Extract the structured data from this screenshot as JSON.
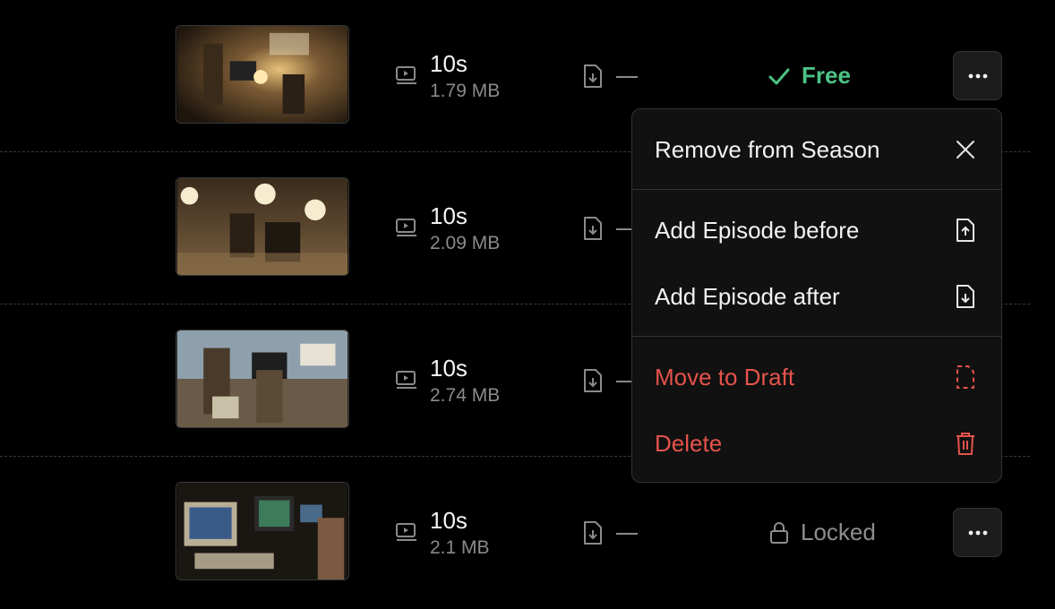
{
  "episodes": [
    {
      "duration": "10s",
      "size": "1.79 MB",
      "status": "Free",
      "thumb": "vintage-projector-scene"
    },
    {
      "duration": "10s",
      "size": "2.09 MB",
      "status": "",
      "thumb": "film-studio-set"
    },
    {
      "duration": "10s",
      "size": "2.74 MB",
      "status": "",
      "thumb": "street-protest-camera"
    },
    {
      "duration": "10s",
      "size": "2.1 MB",
      "status": "Locked",
      "thumb": "retro-editing-room"
    }
  ],
  "menu": {
    "remove_label": "Remove from Season",
    "add_before_label": "Add Episode before",
    "add_after_label": "Add Episode after",
    "move_draft_label": "Move to Draft",
    "delete_label": "Delete"
  },
  "icons": {
    "media": "video-icon",
    "download": "file-download-icon",
    "more": "more-horizontal-icon",
    "free": "check-icon",
    "locked": "lock-icon",
    "remove": "close-icon",
    "add_before": "file-upload-icon",
    "add_after": "file-download-icon",
    "draft": "dashed-file-icon",
    "delete": "trash-icon"
  },
  "colors": {
    "background": "#000000",
    "free": "#4cc285",
    "danger": "#e5534b",
    "muted": "#8a8a8a",
    "menu_bg": "#111111"
  }
}
